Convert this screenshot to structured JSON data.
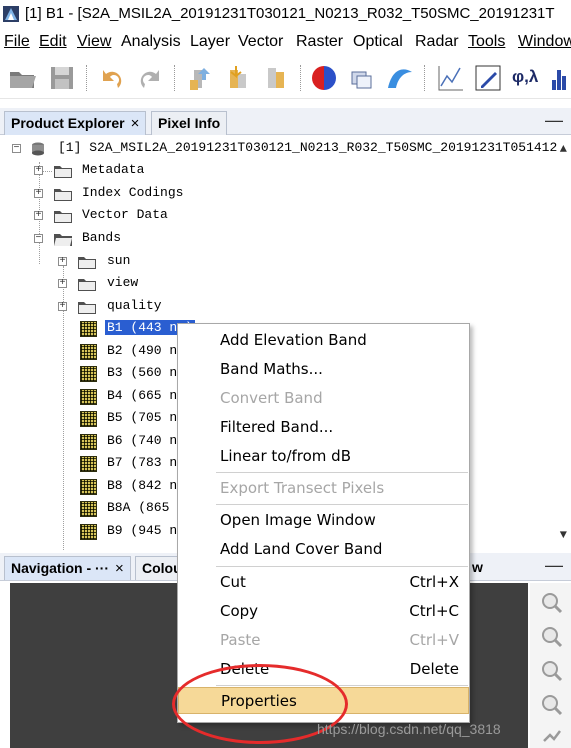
{
  "window": {
    "title": "[1] B1 - [S2A_MSIL2A_20191231T030121_N0213_R032_T50SMC_20191231T"
  },
  "menubar": {
    "items": [
      {
        "label": "File",
        "mnemonic": "F"
      },
      {
        "label": "Edit",
        "mnemonic": "E"
      },
      {
        "label": "View",
        "mnemonic": "V"
      },
      {
        "label": "Analysis"
      },
      {
        "label": "Layer"
      },
      {
        "label": "Vector"
      },
      {
        "label": "Raster"
      },
      {
        "label": "Optical"
      },
      {
        "label": "Radar"
      },
      {
        "label": "Tools",
        "mnemonic": "T"
      },
      {
        "label": "Window",
        "mnemonic": "W"
      }
    ]
  },
  "toolbar": {
    "phi_lambda": "φ,λ",
    "icons": [
      "open-product-icon",
      "save-product-icon",
      "undo-icon",
      "redo-icon",
      "import-band-icon",
      "band-maths-icon",
      "export-icon",
      "color-manipulation-icon",
      "layer-manager-icon",
      "wave-icon",
      "spectrum-view-icon",
      "pin-edit-icon",
      "world-map-icon",
      "histogram-icon"
    ]
  },
  "product_explorer": {
    "tabs": [
      {
        "label": "Product Explorer",
        "close": "×"
      },
      {
        "label": "Pixel Info"
      }
    ],
    "minimize": "—",
    "product_label": "[1]  S2A_MSIL2A_20191231T030121_N0213_R032_T50SMC_20191231T051412",
    "nodes": {
      "metadata": "Metadata",
      "index_codings": "Index Codings",
      "vector_data": "Vector Data",
      "bands": "Bands",
      "sun": "sun",
      "view": "view",
      "quality": "quality"
    },
    "bands": [
      "B1 (443 nm)",
      "B2 (490 nm)",
      "B3 (560 nm)",
      "B4 (665 nm)",
      "B5 (705 nm)",
      "B6 (740 nm)",
      "B7 (783 nm)",
      "B8 (842 nm)",
      "B8A (865 nm)",
      "B9 (945 nm)"
    ],
    "expand_glyph": "+",
    "collapse_glyph": "−"
  },
  "bottom_panel": {
    "nav_tab": "Navigation - ···",
    "nav_close": "×",
    "colour_tab": "Colou",
    "partial_tab": "w",
    "minimize": "—"
  },
  "context_menu": {
    "items": [
      {
        "label": "Add Elevation Band",
        "enabled": true
      },
      {
        "label": "Band Maths...",
        "enabled": true
      },
      {
        "label": "Convert Band",
        "enabled": false
      },
      {
        "label": "Filtered Band...",
        "enabled": true
      },
      {
        "label": "Linear to/from dB",
        "enabled": true
      },
      {
        "label": "Export Transect Pixels",
        "enabled": false
      },
      {
        "label": "Open Image Window",
        "enabled": true
      },
      {
        "label": "Add Land Cover Band",
        "enabled": true
      },
      {
        "label": "Cut",
        "accel": "Ctrl+X",
        "enabled": true
      },
      {
        "label": "Copy",
        "accel": "Ctrl+C",
        "enabled": true
      },
      {
        "label": "Paste",
        "accel": "Ctrl+V",
        "enabled": false
      },
      {
        "label": "Delete",
        "accel": "Delete",
        "enabled": true
      },
      {
        "label": "Properties",
        "enabled": true,
        "highlighted": true
      }
    ]
  },
  "annotation": {
    "ellipse_color": "#e52b2b",
    "watermark": "https://blog.csdn.net/qq_3818"
  },
  "colors": {
    "selection": "#2a5ed1",
    "highlight": "#f6d998",
    "nav_background": "#3f3f3f"
  }
}
